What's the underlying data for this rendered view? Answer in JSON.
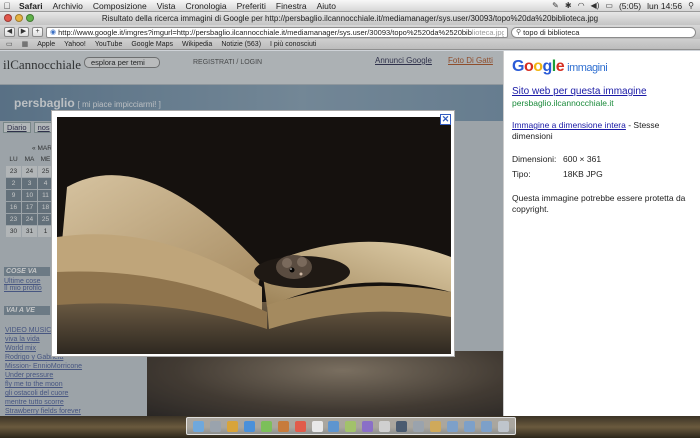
{
  "menubar": {
    "items": [
      "Safari",
      "Archivio",
      "Composizione",
      "Vista",
      "Cronologia",
      "Preferiti",
      "Finestra",
      "Aiuto"
    ],
    "battery": "(5:05)",
    "clock": "lun 14:56"
  },
  "window": {
    "title": "Risultato della ricerca immagini di Google per http://persbaglio.ilcannocchiale.it/mediamanager/sys.user/30093/topo%20da%20biblioteca.jpg"
  },
  "toolbar": {
    "url": "http://www.google.it/imgres?imgurl=http://persbaglio.ilcannocchiale.it/mediamanager/sys.user/30093/topo%2520da%2520bib",
    "url_tail": "lioteca.jpg&imgrefurl",
    "search_value": "topo di biblioteca"
  },
  "bookmarks": [
    "Apple",
    "Yahoo!",
    "YouTube",
    "Google Maps",
    "Wikipedia",
    "Notizie (563)",
    "I più conosciuti"
  ],
  "blog": {
    "logo": "ilCannocchiale",
    "explore": "esplora per temi",
    "register": "REGISTRATI / LOGIN",
    "annunci": "Annunci Google",
    "foto": "Foto Di Gatti",
    "name": "persbaglio",
    "tagline": "[ mi piace impicciarmi! ]",
    "tabs": [
      "Diario",
      "nos",
      "c"
    ],
    "cal_month": "MAR",
    "cal_nav": "«",
    "cal_head": [
      "LU",
      "MA",
      "ME"
    ],
    "cal_days": [
      "23",
      "24",
      "25",
      "2",
      "3",
      "4",
      "9",
      "10",
      "11",
      "16",
      "17",
      "18",
      "23",
      "24",
      "25",
      "30",
      "31",
      "1"
    ],
    "side_head1": "COSE VA",
    "side_links1": [
      "Ultime cose",
      "Il mio profilo"
    ],
    "side_head2": "VAI A VE",
    "side_links2": [
      "VIDEO MUSIC",
      "viva la vida",
      "World mix",
      "Rodrigo y Gabriela",
      "Mission- EnnioMorricone",
      "Under pressure",
      "fly me to the moon",
      "gli ostacoli del cuore",
      "mentre tutto scorre",
      "Strawberry fields forever"
    ]
  },
  "google": {
    "logo_letters": [
      "G",
      "o",
      "o",
      "g",
      "l",
      "e"
    ],
    "product": "immagini",
    "site_link": "Sito web per questa immagine",
    "domain": "persbaglio.ilcannocchiale.it",
    "full_link": "Immagine a dimensione intera",
    "full_rest": " - Stesse dimensioni",
    "dim_label": "Dimensioni:",
    "dim_value": "600 × 361",
    "type_label": "Tipo:",
    "type_value": "18KB JPG",
    "warning": "Questa immagine potrebbe essere protetta da copyright."
  },
  "image": {
    "close_label": "✕"
  }
}
